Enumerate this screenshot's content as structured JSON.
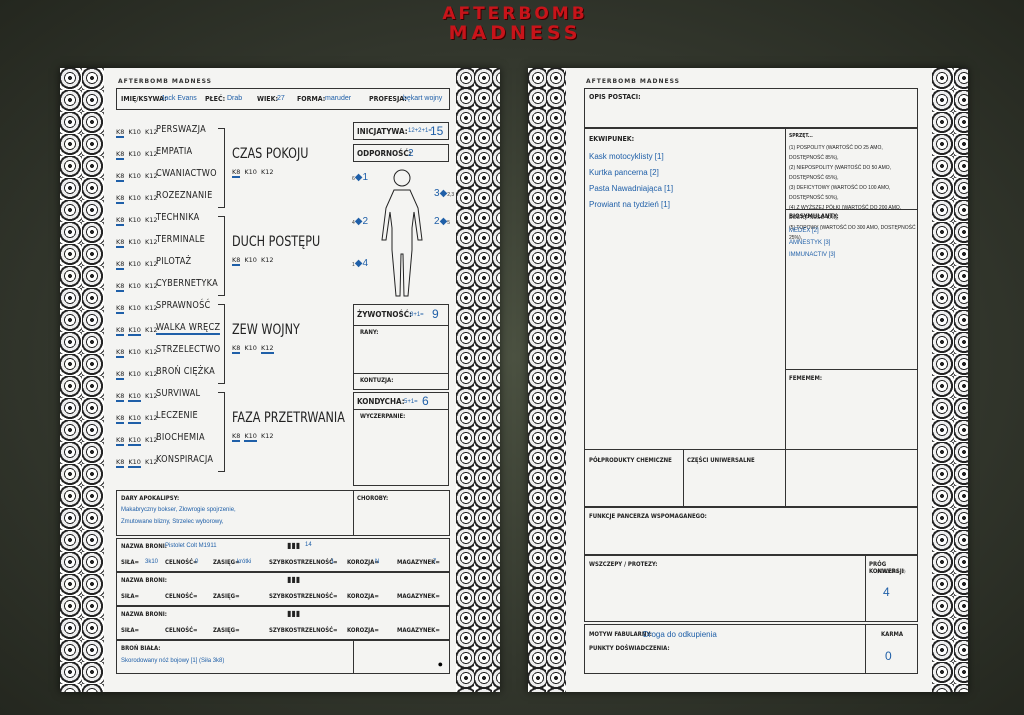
{
  "logo": {
    "line1": "AFTERBOMB",
    "line2": "MADNESS"
  },
  "left": {
    "mini_title": "AFTERBOMB MADNESS",
    "header": {
      "name_label": "IMIĘ/KSYWA:",
      "name": "Jack Evans",
      "sex_label": "PŁEĆ:",
      "sex": "Drab",
      "age_label": "WIEK:",
      "age": "27",
      "form_label": "FORMA:",
      "form": "maruder",
      "prof_label": "PROFESJA:",
      "prof": "bękart wojny"
    },
    "dice": [
      "K8",
      "K10",
      "K12"
    ],
    "groups": [
      {
        "phase": "CZAS POKOJU",
        "skills": [
          "PERSWAZJA",
          "EMPATIA",
          "CWANIACTWO",
          "ROZEZNANIE"
        ]
      },
      {
        "phase": "DUCH POSTĘPU",
        "skills": [
          "TECHNIKA",
          "TERMINALE",
          "PILOTAŻ",
          "CYBERNETYKA"
        ]
      },
      {
        "phase": "ZEW WOJNY",
        "skills": [
          "SPRAWNOŚĆ",
          "WALKA WRĘCZ",
          "STRZELECTWO",
          "BROŃ CIĘŻKA"
        ]
      },
      {
        "phase": "FAZA PRZETRWANIA",
        "skills": [
          "SURVIWAL",
          "LECZENIE",
          "BIOCHEMIA",
          "KONSPIRACJA"
        ]
      }
    ],
    "init": {
      "label": "INICJATYWA:",
      "formula": "12+2+1=",
      "value": "15"
    },
    "resist": {
      "label": "ODPORNOŚĆ:",
      "value": "2"
    },
    "armor": {
      "head": "1",
      "r_arm": "3",
      "torso_l": "2",
      "torso_r": "2",
      "legs": "4"
    },
    "life": {
      "label": "ŻYWOTNOŚĆ:",
      "formula": "8+1=",
      "value": "9",
      "wounds": "RANY:",
      "contusion": "KONTUZJA:"
    },
    "cond": {
      "label": "KONDYCHA:",
      "formula": "5+1=",
      "value": "6",
      "fatigue": "WYCZERPANIE:"
    },
    "gifts": {
      "label": "DARY APOKALIPSY:",
      "text1": "Makabryczny bokser, Złowrogie spojrzenie,",
      "text2": "Zmutowane blizny, Strzelec wyborowy,"
    },
    "diseases": {
      "label": "CHOROBY:"
    },
    "weapons": [
      {
        "name_label": "NAZWA BRONI:",
        "name": "Pistolet Colt M1911",
        "ammo": "14",
        "sila_label": "SIŁA=",
        "sila": "3k10",
        "cel_label": "CELNOŚĆ=",
        "cel": "0",
        "zas_label": "ZASIĘG=",
        "zas": "krótki",
        "szyb_label": "SZYBKOSTRZELNOŚĆ=",
        "szyb": "1",
        "kor_label": "KOROZJA=",
        "kor": "N",
        "mag_label": "MAGAZYNEK=",
        "mag": "7"
      },
      {
        "name_label": "NAZWA BRONI:",
        "name": "",
        "ammo": "",
        "sila_label": "SIŁA=",
        "sila": "",
        "cel_label": "CELNOŚĆ=",
        "cel": "",
        "zas_label": "ZASIĘG=",
        "zas": "",
        "szyb_label": "SZYBKOSTRZELNOŚĆ=",
        "szyb": "",
        "kor_label": "KOROZJA=",
        "kor": "",
        "mag_label": "MAGAZYNEK=",
        "mag": ""
      },
      {
        "name_label": "NAZWA BRONI:",
        "name": "",
        "ammo": "",
        "sila_label": "SIŁA=",
        "sila": "",
        "cel_label": "CELNOŚĆ=",
        "cel": "",
        "zas_label": "ZASIĘG=",
        "zas": "",
        "szyb_label": "SZYBKOSTRZELNOŚĆ=",
        "szyb": "",
        "kor_label": "KOROZJA=",
        "kor": "",
        "mag_label": "MAGAZYNEK=",
        "mag": ""
      }
    ],
    "melee": {
      "label": "BROŃ BIAŁA:",
      "text": "Skorodowany nóż bojowy [1] (Siła 3k8)"
    }
  },
  "right": {
    "mini_title": "AFTERBOMB MADNESS",
    "desc_label": "OPIS POSTACI:",
    "equip_label": "EKWIPUNEK:",
    "equip": [
      "Kask motocyklisty [1]",
      "Kurtka pancerna [2]",
      "Pasta Nawadniająca [1]",
      "Prowiant na tydzień [1]"
    ],
    "gear_label": "SPRZĘT...",
    "gear": [
      "(1) POSPOLITY (WARTOŚĆ DO 25 AMO, DOSTĘPNOŚĆ 85%),",
      "(2) NIEPOSPOLITY (WARTOŚĆ DO 50 AMO, DOSTĘPNOŚĆ 65%),",
      "(3) DEFICYTOWY (WARTOŚĆ DO 100 AMO, DOSTĘPNOŚĆ 50%),",
      "(4) Z WYŻSZEJ PÓŁKI (WARTOŚĆ DO 200 AMO, DOSTĘPNOŚĆ 40%),",
      "(5) TOPOWY (WARTOŚĆ DO 300 AMO, DOSTĘPNOŚĆ 25%),"
    ],
    "bio_label": "BIOSYMULANTY:",
    "bio": [
      "MEDEX [2]",
      "AMNESTYK [3]",
      "IMMUNACTIV [3]"
    ],
    "fem_label": "FEMEMEM:",
    "chem_label": "PÓŁPRODUKTY CHEMICZNE",
    "parts_label": "CZĘŚCI UNIWERSALNE",
    "armor_func_label": "FUNKCJE PANCERZA WSPOMAGANEGO:",
    "implants_label": "WSZCZEPY / PROTEZY:",
    "conv_label": "PRÓG KONWERSJI",
    "conv_sub": "(KONDYCHA - 2)",
    "conv_value": "4",
    "motive_label": "MOTYW FABULARNY:",
    "motive": "Droga do odkupienia",
    "xp_label": "PUNKTY DOŚWIADCZENIA:",
    "karma_label": "KARMA",
    "karma_value": "0"
  }
}
